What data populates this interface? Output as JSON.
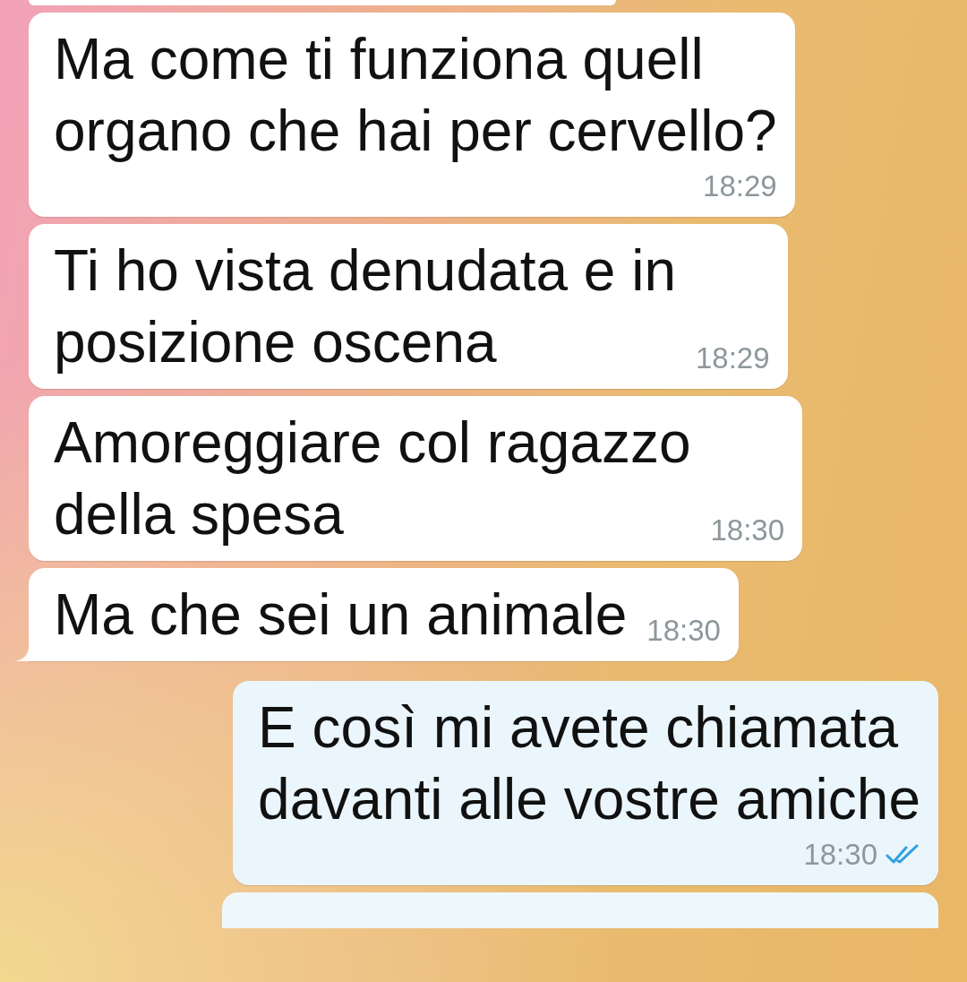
{
  "messages": [
    {
      "kind": "incoming",
      "text": "Ma come ti funziona quell\norgano che hai per cervello?",
      "time": "18:29",
      "tail": false
    },
    {
      "kind": "incoming",
      "text": "Ti ho vista denudata e in\nposizione oscena",
      "time": "18:29",
      "tail": false
    },
    {
      "kind": "incoming",
      "text": "Amoreggiare col ragazzo\ndella spesa",
      "time": "18:30",
      "tail": false
    },
    {
      "kind": "incoming",
      "text": "Ma che sei un animale",
      "time": "18:30",
      "tail": true
    },
    {
      "kind": "outgoing",
      "text": "E così mi avete chiamata\ndavanti alle vostre amiche",
      "time": "18:30",
      "tail": false,
      "read": true
    }
  ]
}
